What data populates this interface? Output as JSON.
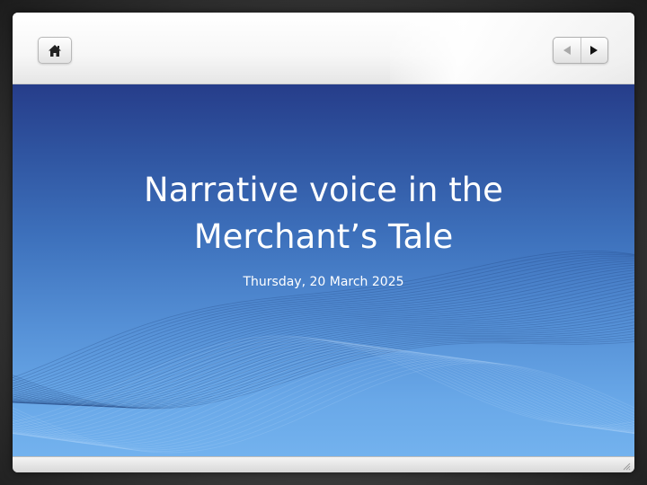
{
  "toolbar": {
    "home_icon": "home-icon",
    "prev_icon": "triangle-left-icon",
    "next_icon": "triangle-right-icon"
  },
  "slide": {
    "title_line1": "Narrative voice in the",
    "title_line2": "Merchant’s Tale",
    "date": "Thursday, 20 March 2025"
  },
  "colors": {
    "slide_top": "#263d8a",
    "slide_bottom": "#73b2ee",
    "text": "#ffffff"
  }
}
